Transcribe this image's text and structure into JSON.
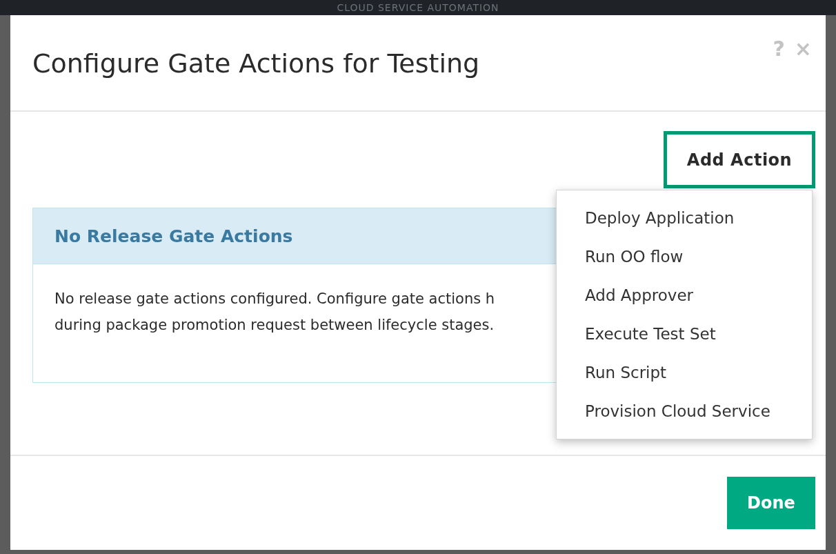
{
  "background": {
    "app_title": "CLOUD SERVICE AUTOMATION"
  },
  "dialog": {
    "title": "Configure Gate Actions for Testing",
    "help": "?",
    "close": "×",
    "add_action_button": {
      "label": "Add Action",
      "expanded": true
    },
    "menu": [
      "Deploy Application",
      "Run OO flow",
      "Add Approver",
      "Execute Test Set",
      "Run Script",
      "Provision Cloud Service"
    ],
    "panel": {
      "title": "No Release Gate Actions",
      "lines": [
        "No release gate actions configured. Configure gate actions h",
        "during package promotion request between lifecycle stages."
      ]
    },
    "buttons": [
      "Done"
    ]
  }
}
